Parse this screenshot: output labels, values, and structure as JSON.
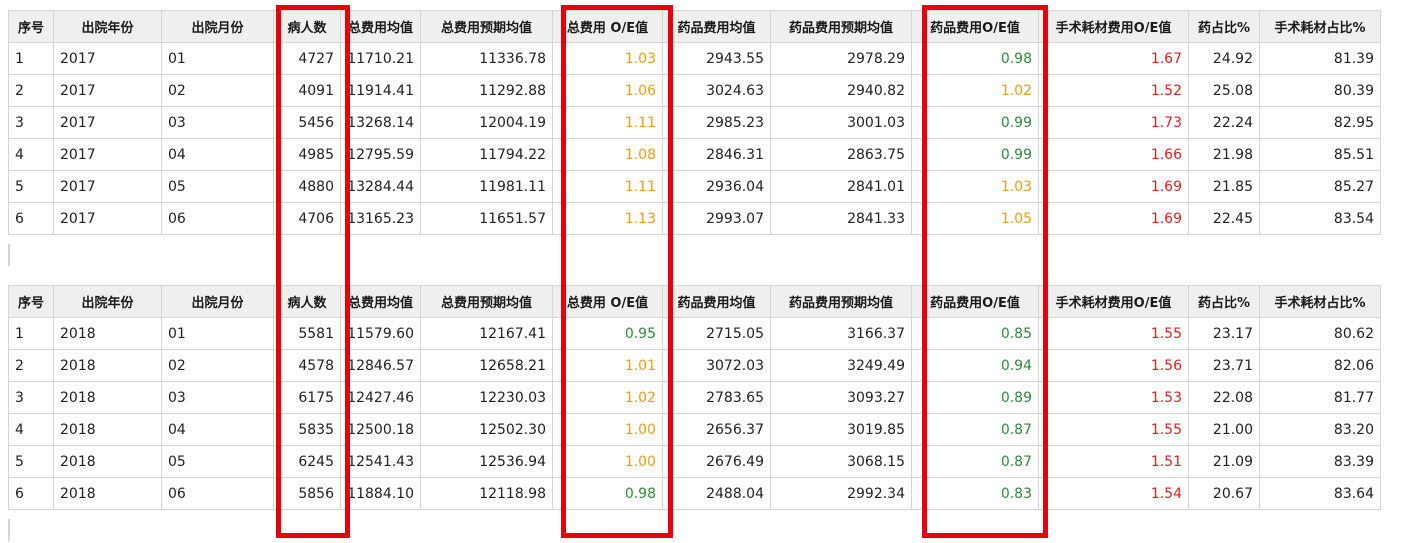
{
  "columns": [
    "序号",
    "出院年份",
    "出院月份",
    "病人数",
    "总费用均值",
    "总费用预期均值",
    "总费用 O/E值",
    "药品费用均值",
    "药品费用预期均值",
    "药品费用O/E值",
    "手术耗材费用O/E值",
    "药占比%",
    "手术耗材占比%"
  ],
  "colors": {
    "orange": "#f39c12",
    "green": "#2e8b3a",
    "red": "#e02020",
    "highlight": "#e8000b"
  },
  "tables": [
    {
      "year": "2017",
      "rows": [
        {
          "seq": "1",
          "year": "2017",
          "month": "01",
          "patients": "4727",
          "total_mean": "11710.21",
          "total_expected": "11336.78",
          "total_oe": "1.03",
          "total_oe_color": "orange",
          "drug_mean": "2943.55",
          "drug_expected": "2978.29",
          "drug_oe": "0.98",
          "drug_oe_color": "green",
          "surg_oe": "1.67",
          "drug_pct": "24.92",
          "surg_pct": "81.39"
        },
        {
          "seq": "2",
          "year": "2017",
          "month": "02",
          "patients": "4091",
          "total_mean": "11914.41",
          "total_expected": "11292.88",
          "total_oe": "1.06",
          "total_oe_color": "orange",
          "drug_mean": "3024.63",
          "drug_expected": "2940.82",
          "drug_oe": "1.02",
          "drug_oe_color": "orange",
          "surg_oe": "1.52",
          "drug_pct": "25.08",
          "surg_pct": "80.39"
        },
        {
          "seq": "3",
          "year": "2017",
          "month": "03",
          "patients": "5456",
          "total_mean": "13268.14",
          "total_expected": "12004.19",
          "total_oe": "1.11",
          "total_oe_color": "orange",
          "drug_mean": "2985.23",
          "drug_expected": "3001.03",
          "drug_oe": "0.99",
          "drug_oe_color": "green",
          "surg_oe": "1.73",
          "drug_pct": "22.24",
          "surg_pct": "82.95"
        },
        {
          "seq": "4",
          "year": "2017",
          "month": "04",
          "patients": "4985",
          "total_mean": "12795.59",
          "total_expected": "11794.22",
          "total_oe": "1.08",
          "total_oe_color": "orange",
          "drug_mean": "2846.31",
          "drug_expected": "2863.75",
          "drug_oe": "0.99",
          "drug_oe_color": "green",
          "surg_oe": "1.66",
          "drug_pct": "21.98",
          "surg_pct": "85.51"
        },
        {
          "seq": "5",
          "year": "2017",
          "month": "05",
          "patients": "4880",
          "total_mean": "13284.44",
          "total_expected": "11981.11",
          "total_oe": "1.11",
          "total_oe_color": "orange",
          "drug_mean": "2936.04",
          "drug_expected": "2841.01",
          "drug_oe": "1.03",
          "drug_oe_color": "orange",
          "surg_oe": "1.69",
          "drug_pct": "21.85",
          "surg_pct": "85.27"
        },
        {
          "seq": "6",
          "year": "2017",
          "month": "06",
          "patients": "4706",
          "total_mean": "13165.23",
          "total_expected": "11651.57",
          "total_oe": "1.13",
          "total_oe_color": "orange",
          "drug_mean": "2993.07",
          "drug_expected": "2841.33",
          "drug_oe": "1.05",
          "drug_oe_color": "orange",
          "surg_oe": "1.69",
          "drug_pct": "22.45",
          "surg_pct": "83.54"
        }
      ]
    },
    {
      "year": "2018",
      "rows": [
        {
          "seq": "1",
          "year": "2018",
          "month": "01",
          "patients": "5581",
          "total_mean": "11579.60",
          "total_expected": "12167.41",
          "total_oe": "0.95",
          "total_oe_color": "green",
          "drug_mean": "2715.05",
          "drug_expected": "3166.37",
          "drug_oe": "0.85",
          "drug_oe_color": "green",
          "surg_oe": "1.55",
          "drug_pct": "23.17",
          "surg_pct": "80.62"
        },
        {
          "seq": "2",
          "year": "2018",
          "month": "02",
          "patients": "4578",
          "total_mean": "12846.57",
          "total_expected": "12658.21",
          "total_oe": "1.01",
          "total_oe_color": "orange",
          "drug_mean": "3072.03",
          "drug_expected": "3249.49",
          "drug_oe": "0.94",
          "drug_oe_color": "green",
          "surg_oe": "1.56",
          "drug_pct": "23.71",
          "surg_pct": "82.06"
        },
        {
          "seq": "3",
          "year": "2018",
          "month": "03",
          "patients": "6175",
          "total_mean": "12427.46",
          "total_expected": "12230.03",
          "total_oe": "1.02",
          "total_oe_color": "orange",
          "drug_mean": "2783.65",
          "drug_expected": "3093.27",
          "drug_oe": "0.89",
          "drug_oe_color": "green",
          "surg_oe": "1.53",
          "drug_pct": "22.08",
          "surg_pct": "81.77"
        },
        {
          "seq": "4",
          "year": "2018",
          "month": "04",
          "patients": "5835",
          "total_mean": "12500.18",
          "total_expected": "12502.30",
          "total_oe": "1.00",
          "total_oe_color": "orange",
          "drug_mean": "2656.37",
          "drug_expected": "3019.85",
          "drug_oe": "0.87",
          "drug_oe_color": "green",
          "surg_oe": "1.55",
          "drug_pct": "21.00",
          "surg_pct": "83.20"
        },
        {
          "seq": "5",
          "year": "2018",
          "month": "05",
          "patients": "6245",
          "total_mean": "12541.43",
          "total_expected": "12536.94",
          "total_oe": "1.00",
          "total_oe_color": "orange",
          "drug_mean": "2676.49",
          "drug_expected": "3068.15",
          "drug_oe": "0.87",
          "drug_oe_color": "green",
          "surg_oe": "1.51",
          "drug_pct": "21.09",
          "surg_pct": "83.39"
        },
        {
          "seq": "6",
          "year": "2018",
          "month": "06",
          "patients": "5856",
          "total_mean": "11884.10",
          "total_expected": "12118.98",
          "total_oe": "0.98",
          "total_oe_color": "green",
          "drug_mean": "2488.04",
          "drug_expected": "2992.34",
          "drug_oe": "0.83",
          "drug_oe_color": "green",
          "surg_oe": "1.54",
          "drug_pct": "20.67",
          "surg_pct": "83.64"
        }
      ]
    }
  ]
}
